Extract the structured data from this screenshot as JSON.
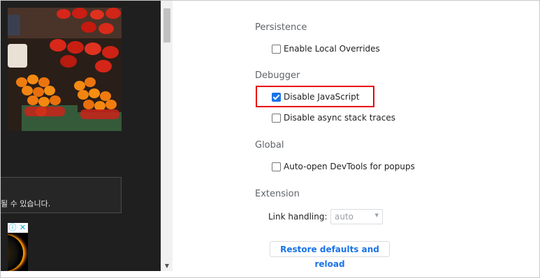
{
  "webpage": {
    "notice_text": "될 수 있습니다.",
    "ad_info_icon": "info-icon",
    "ad_close_icon": "close-icon"
  },
  "scrollbar": {
    "arrow_down_icon": "triangle-down-icon"
  },
  "settings": {
    "persistence": {
      "title": "Persistence",
      "items": [
        {
          "label": "Enable Local Overrides",
          "checked": false
        }
      ]
    },
    "debugger": {
      "title": "Debugger",
      "items": [
        {
          "label": "Disable JavaScript",
          "checked": true
        },
        {
          "label": "Disable async stack traces",
          "checked": false
        }
      ]
    },
    "global": {
      "title": "Global",
      "items": [
        {
          "label": "Auto-open DevTools for popups",
          "checked": false
        }
      ]
    },
    "extension": {
      "title": "Extension",
      "link_handling_label": "Link handling:",
      "link_handling_value": "auto"
    },
    "restore_button_label": "Restore defaults and reload"
  },
  "colors": {
    "highlight": "#e8000b",
    "accent": "#1a73e8"
  }
}
